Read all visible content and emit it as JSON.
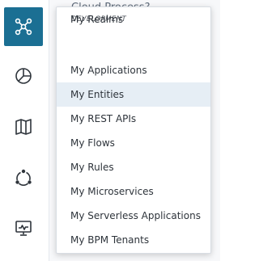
{
  "background": {
    "title": "Cloud Process?"
  },
  "sidebar": {
    "items": [
      {
        "icon": "integrations-icon",
        "active": true
      },
      {
        "icon": "analytics-icon",
        "active": false
      },
      {
        "icon": "map-icon",
        "active": false
      },
      {
        "icon": "network-icon",
        "active": false
      },
      {
        "icon": "monitor-icon",
        "active": false
      }
    ]
  },
  "menu": {
    "header": "DEVELOPMENT",
    "items": [
      {
        "label": "My Applications"
      },
      {
        "label": "My Entities",
        "highlighted": true
      },
      {
        "label": "My REST APIs"
      },
      {
        "label": "My Flows"
      },
      {
        "label": "My Rules"
      },
      {
        "label": "My Microservices"
      },
      {
        "label": "My Serverless Applications"
      },
      {
        "label": "My BPM Tenants"
      },
      {
        "label": "My Realms"
      }
    ]
  },
  "colors": {
    "accent": "#1b6f93",
    "highlight": "#e6eef5",
    "text": "#2e343b"
  }
}
